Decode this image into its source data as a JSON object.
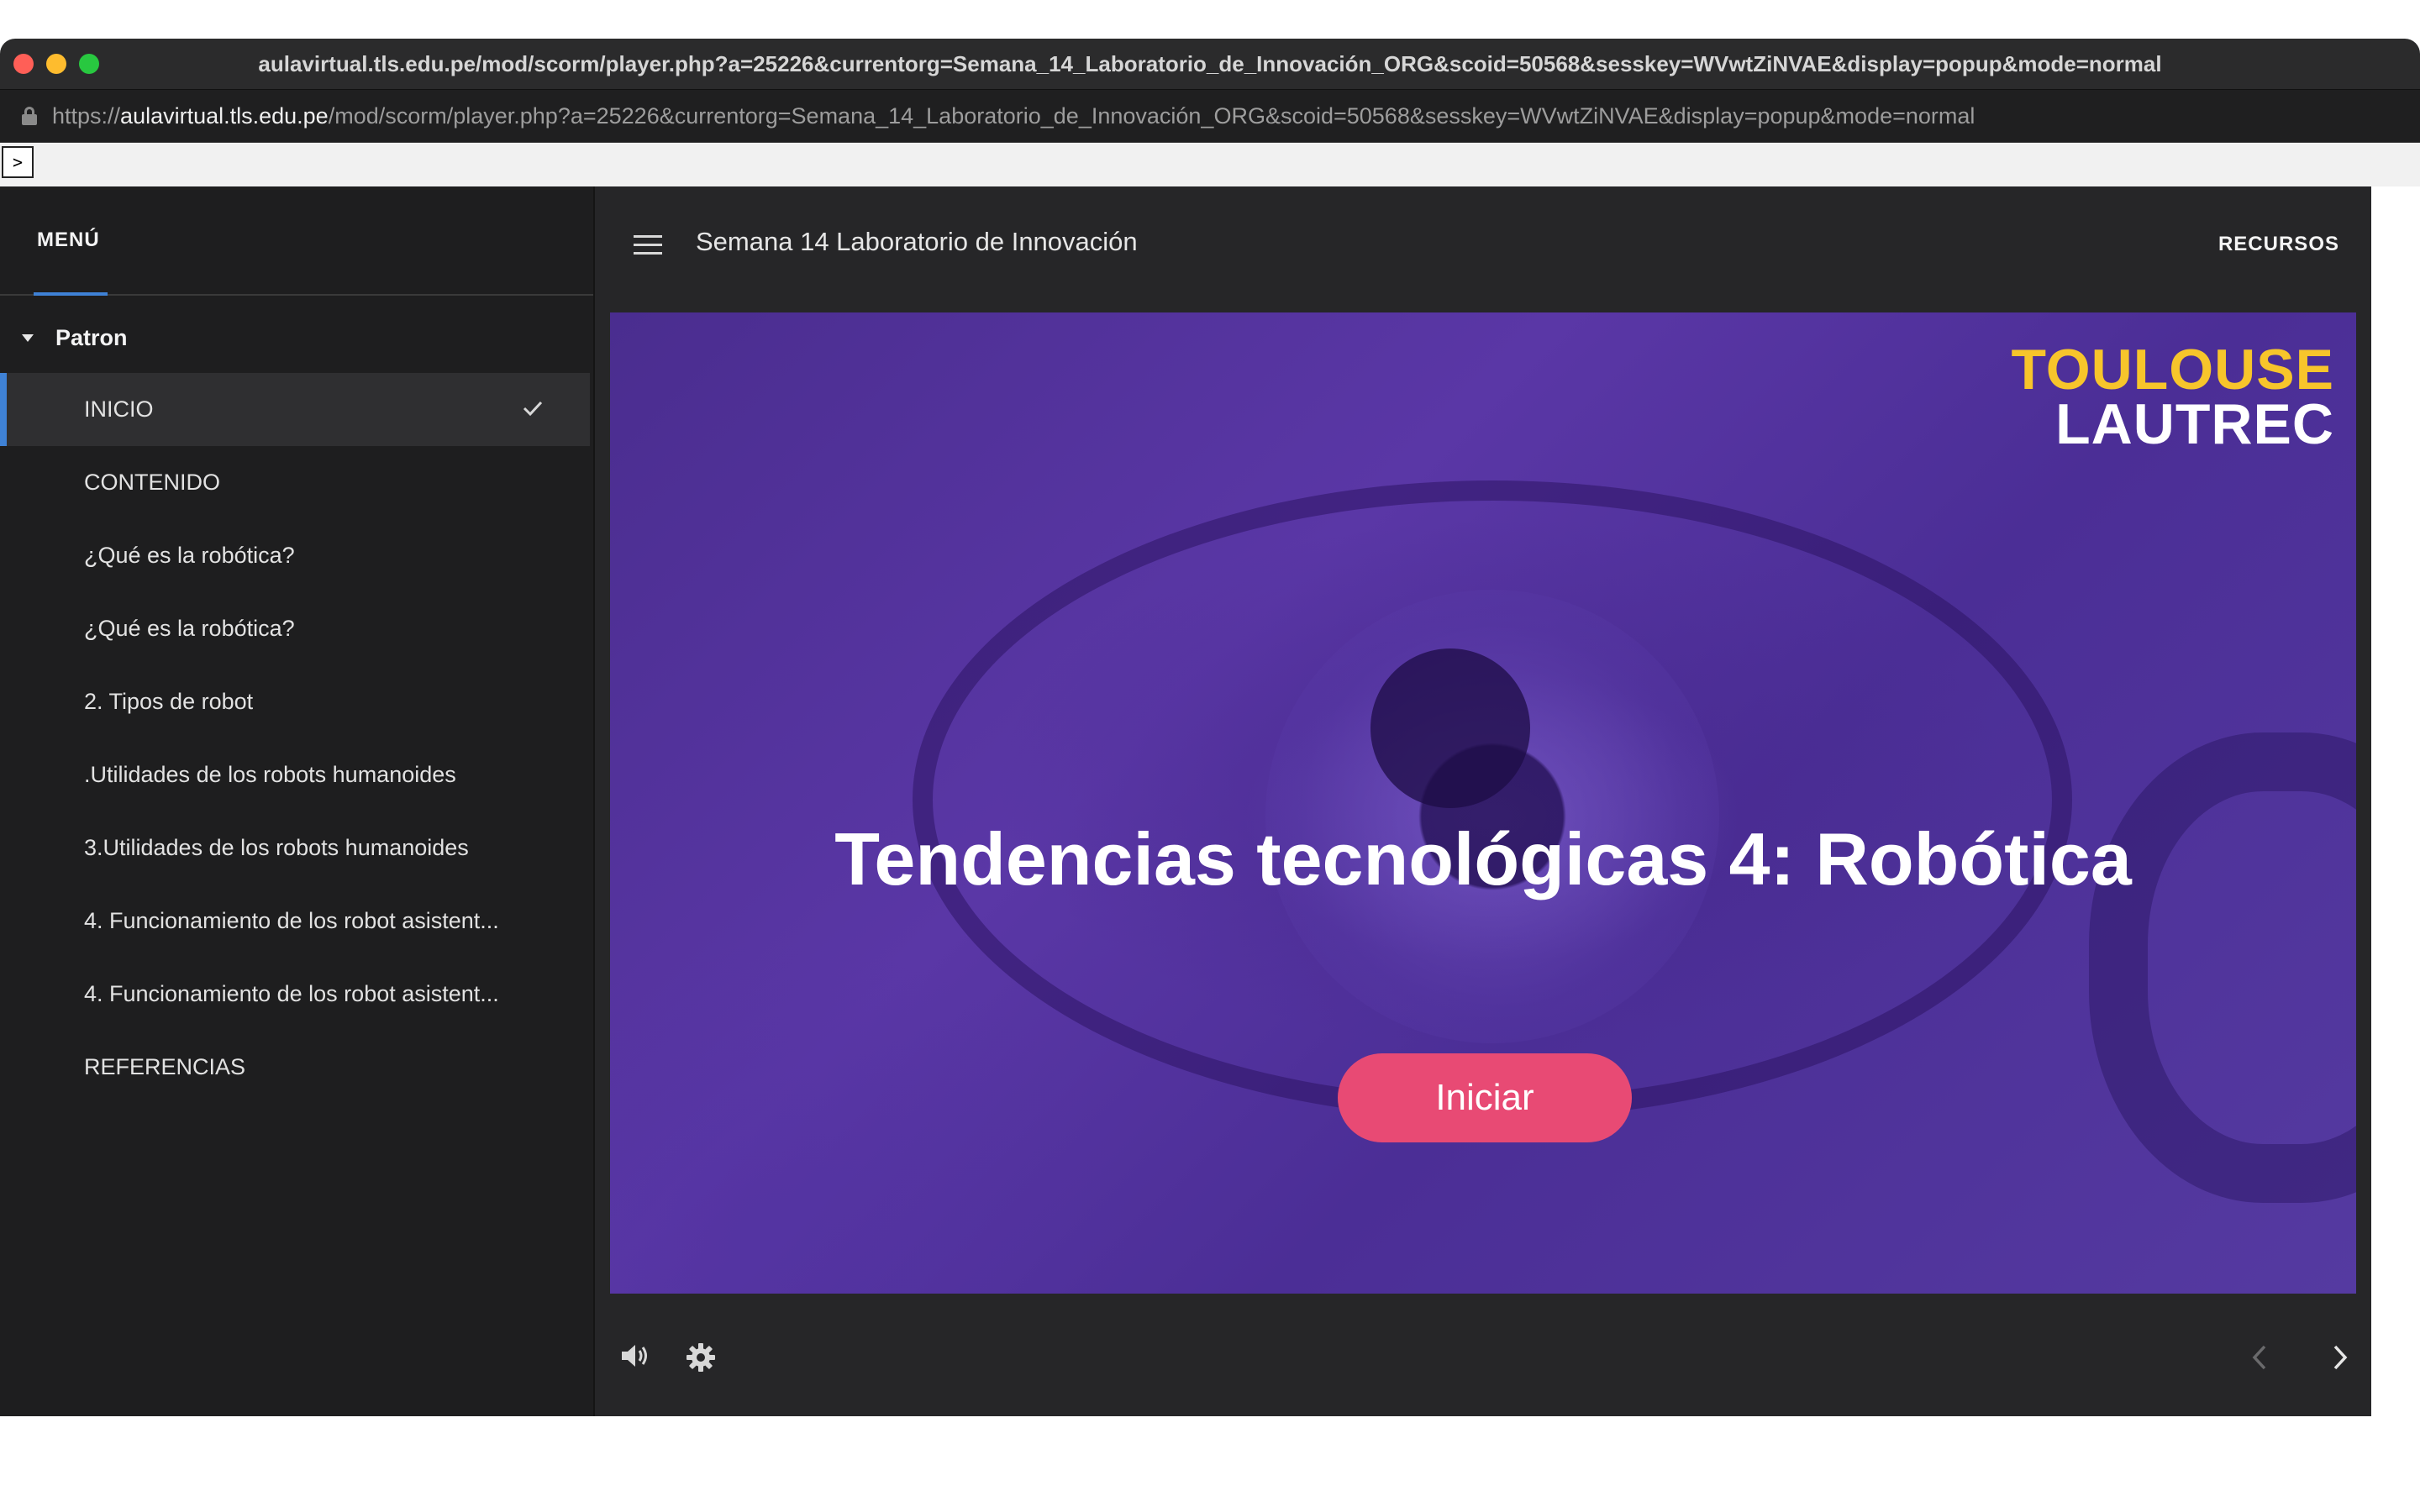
{
  "browser": {
    "window_title": "aulavirtual.tls.edu.pe/mod/scorm/player.php?a=25226&currentorg=Semana_14_Laboratorio_de_Innovación_ORG&scoid=50568&sesskey=WVwtZiNVAE&display=popup&mode=normal",
    "url_scheme": "https://",
    "url_host": "aulavirtual.tls.edu.pe",
    "url_path": "/mod/scorm/player.php?a=25226&currentorg=Semana_14_Laboratorio_de_Innovación_ORG&scoid=50568&sesskey=WVwtZiNVAE&display=popup&mode=normal"
  },
  "toc_toggle_label": ">",
  "sidebar": {
    "title": "MENÚ",
    "group_label": "Patron",
    "items": [
      {
        "label": "INICIO",
        "active": true
      },
      {
        "label": "CONTENIDO"
      },
      {
        "label": "¿Qué es la robótica?"
      },
      {
        "label": "¿Qué es la robótica?"
      },
      {
        "label": "2. Tipos de robot"
      },
      {
        "label": ".Utilidades de los robots humanoides"
      },
      {
        "label": "3.Utilidades de los robots humanoides"
      },
      {
        "label": "4. Funcionamiento de los robot asistent..."
      },
      {
        "label": "4. Funcionamiento de los robot asistent..."
      },
      {
        "label": "REFERENCIAS"
      }
    ]
  },
  "header": {
    "course_title": "Semana 14 Laboratorio de Innovación",
    "resources_label": "RECURSOS"
  },
  "slide": {
    "logo_line1": "TOULOUSE",
    "logo_line2": "LAUTREC",
    "title": "Tendencias tecnológicas 4: Robótica",
    "start_label": "Iniciar"
  },
  "colors": {
    "accent_blue": "#3f82d6",
    "start_button": "#e84a74",
    "logo_yellow": "#f7c52b",
    "slide_purple": "#4a2d8f"
  },
  "icons": [
    "lock-icon",
    "caret-down-icon",
    "check-icon",
    "hamburger-icon",
    "volume-icon",
    "settings-icon",
    "chevron-left-icon",
    "chevron-right-icon"
  ]
}
